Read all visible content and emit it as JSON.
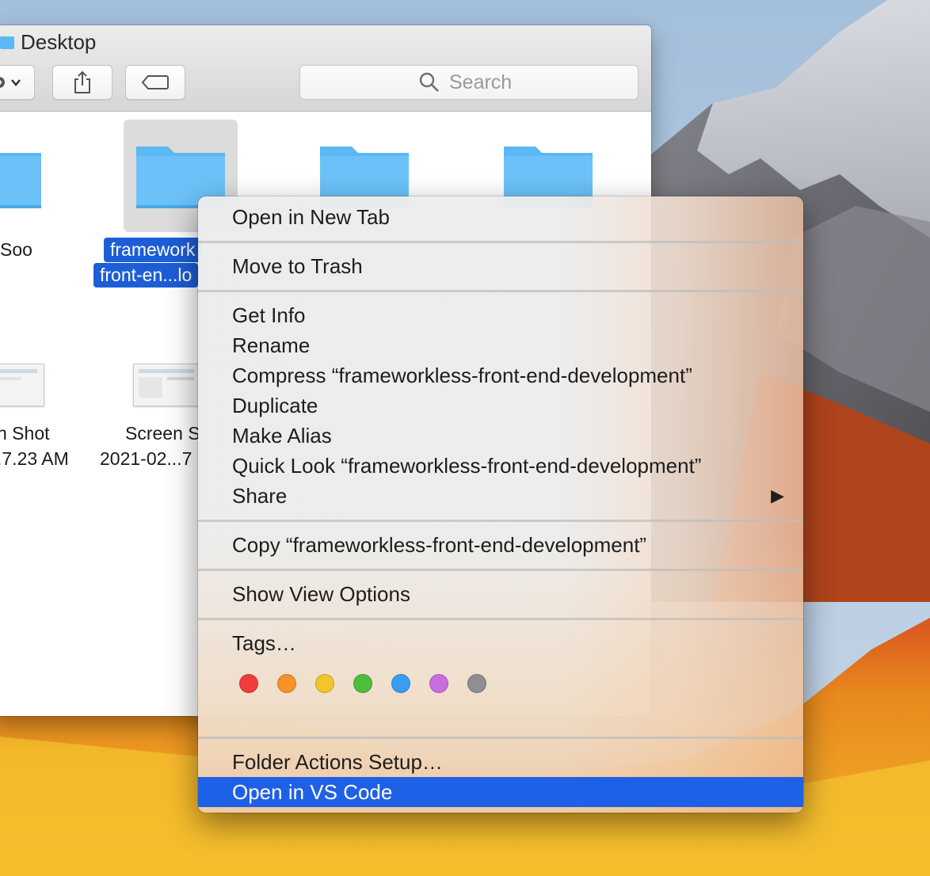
{
  "window": {
    "title": "Desktop"
  },
  "toolbar": {
    "search_placeholder": "Search"
  },
  "files": [
    {
      "label": "Soo"
    },
    {
      "label_line1": "framework",
      "label_line2": "front-en...lo"
    },
    {
      "label_line1": "n Shot",
      "label_line2": ".7.23 AM"
    },
    {
      "label_line1": "Screen S",
      "label_line2": "2021-02...7"
    }
  ],
  "context_menu": {
    "items": [
      {
        "label": "Open in New Tab"
      },
      {
        "label": "Move to Trash"
      },
      {
        "label": "Get Info"
      },
      {
        "label": "Rename"
      },
      {
        "label": "Compress “frameworkless-front-end-development”"
      },
      {
        "label": "Duplicate"
      },
      {
        "label": "Make Alias"
      },
      {
        "label": "Quick Look “frameworkless-front-end-development”"
      },
      {
        "label": "Share"
      },
      {
        "label": "Copy “frameworkless-front-end-development”"
      },
      {
        "label": "Show View Options"
      },
      {
        "label": "Tags…"
      },
      {
        "label": "Folder Actions Setup…"
      },
      {
        "label": "Open in VS Code"
      }
    ],
    "share_arrow": "▶",
    "tag_colors": [
      {
        "name": "red",
        "color": "#f23b3b"
      },
      {
        "name": "orange",
        "color": "#f7922a"
      },
      {
        "name": "yellow",
        "color": "#f3c52b"
      },
      {
        "name": "green",
        "color": "#4dbd3a"
      },
      {
        "name": "blue",
        "color": "#3a9df2"
      },
      {
        "name": "purple",
        "color": "#c76ee0"
      },
      {
        "name": "gray",
        "color": "#8e8e93"
      }
    ],
    "highlight_color": "#1f61e6"
  }
}
